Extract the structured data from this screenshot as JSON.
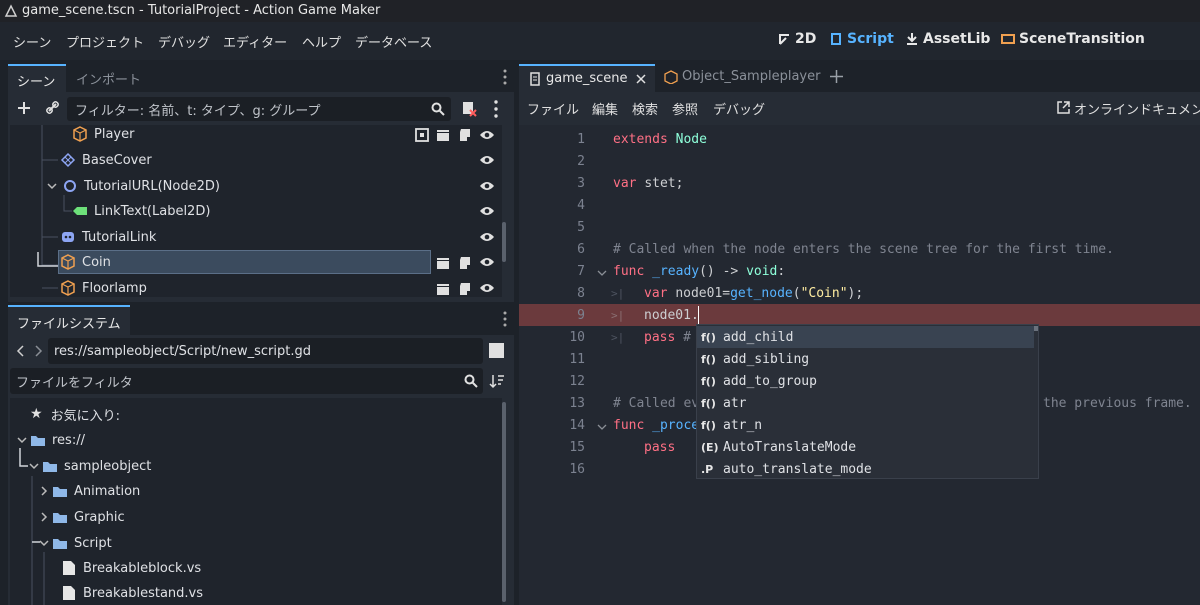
{
  "window": {
    "title": "game_scene.tscn - TutorialProject - Action Game Maker"
  },
  "menu": [
    "シーン",
    "プロジェクト",
    "デバッグ",
    "エディター",
    "ヘルプ",
    "データベース"
  ],
  "workspaces": {
    "w2d": "2D",
    "script": "Script",
    "assetlib": "AssetLib",
    "scene_transition": "SceneTransition"
  },
  "scene_dock": {
    "tabs": [
      "シーン",
      "インポート"
    ],
    "filter_placeholder": "フィルター: 名前、t: タイプ、g: グループ",
    "nodes": [
      {
        "label": "Player",
        "icon": "node3d-box-icon"
      },
      {
        "label": "BaseCover",
        "icon": "tilemap-icon"
      },
      {
        "label": "TutorialURL(Node2D)",
        "icon": "node2d-circle-icon"
      },
      {
        "label": "LinkText(Label2D)",
        "icon": "label-icon"
      },
      {
        "label": "TutorialLink",
        "icon": "controller-icon"
      },
      {
        "label": "Coin",
        "icon": "box-icon"
      },
      {
        "label": "Floorlamp",
        "icon": "box-icon"
      }
    ]
  },
  "filesystem": {
    "tab": "ファイルシステム",
    "path": "res://sampleobject/Script/new_script.gd",
    "filter_placeholder": "ファイルをフィルタ",
    "favorites": "お気に入り:",
    "items": [
      "res://",
      "sampleobject",
      "Animation",
      "Graphic",
      "Script",
      "Breakableblock.vs",
      "Breakablestand.vs"
    ]
  },
  "script_tabs": [
    "game_scene",
    "Object_Sampleplayer"
  ],
  "script_menu": [
    "ファイル",
    "編集",
    "検索",
    "参照",
    "デバッグ"
  ],
  "online_docs": "オンラインドキュメント",
  "code_lines": [
    "1",
    "2",
    "3",
    "4",
    "5",
    "6",
    "7",
    "8",
    "9",
    "10",
    "11",
    "12",
    "13",
    "14",
    "15",
    "16"
  ],
  "code": {
    "l1a": "extends",
    "l1b": "Node",
    "l3a": "var",
    "l3b": "stet;",
    "l6": "# Called when the node enters the scene tree for the first time.",
    "l7a": "func",
    "l7b": "_ready",
    "l7c": "() -> ",
    "l7d": "void",
    "l7e": ":",
    "l8a": "var",
    "l8b": "node01=",
    "l8c": "get_node",
    "l8d": "(",
    "l8e": "\"Coin\"",
    "l8f": ");",
    "l9": "node01.",
    "l10a": "pass",
    "l10b": "#",
    "l13a": "# Called ev",
    "l13b": "the previous frame.",
    "l14a": "func",
    "l14b": "_proce",
    "l15": "pass"
  },
  "autocomplete": [
    {
      "label": "add_child",
      "icon": "f()"
    },
    {
      "label": "add_sibling",
      "icon": "f()"
    },
    {
      "label": "add_to_group",
      "icon": "f()"
    },
    {
      "label": "atr",
      "icon": "f()"
    },
    {
      "label": "atr_n",
      "icon": "f()"
    },
    {
      "label": "AutoTranslateMode",
      "icon": "(E)"
    },
    {
      "label": "auto_translate_mode",
      "icon": ".P"
    }
  ],
  "colors": {
    "accent": "#57b3ff",
    "error_line": "#6b3a3d",
    "selection": "#3b4b5e",
    "folder": "#8fb8e8"
  }
}
